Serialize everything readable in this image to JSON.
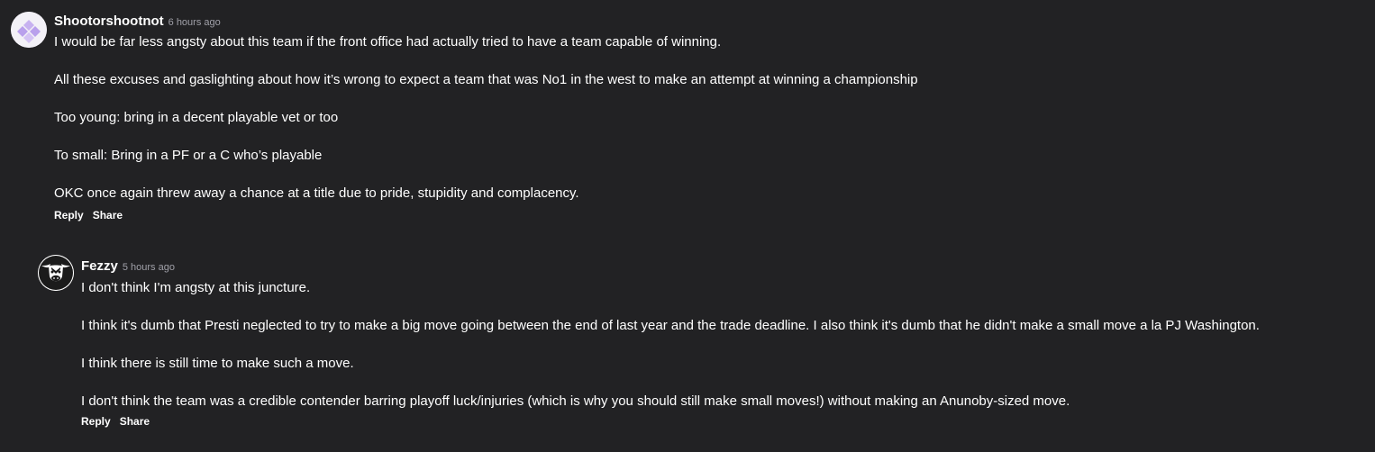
{
  "comments": [
    {
      "author": "Shootorshootnot",
      "timestamp": "6 hours ago",
      "avatar_icon": "purple-diamond-avatar-icon",
      "paragraphs": [
        "I would be far less angsty about this team if the front office had actually tried to have a team capable of winning.",
        "All these excuses and gaslighting about how it’s wrong to expect a team that was No1 in the west to make an attempt at winning a championship",
        "Too young: bring in a decent playable vet or too",
        "To small: Bring in a PF or a C who’s playable",
        "OKC once again threw away a chance at a title due to pride, stupidity and complacency."
      ],
      "reply_label": "Reply",
      "share_label": "Share"
    },
    {
      "author": "Fezzy",
      "timestamp": "5 hours ago",
      "avatar_icon": "bull-head-avatar-icon",
      "paragraphs": [
        "I don't think I'm angsty at this juncture.",
        "I think it's dumb that Presti neglected to try to make a big move going between the end of last year and the trade deadline. I also think it's dumb that he didn't make a small move a la PJ Washington.",
        "I think there is still time to make such a move.",
        "I don't think the team was a credible contender barring playoff luck/injuries (which is why you should still make small moves!) without making an Anunoby-sized move."
      ],
      "reply_label": "Reply",
      "share_label": "Share"
    }
  ],
  "colors": {
    "background": "#222224",
    "text": "#ffffff",
    "timestamp": "#a0a0a8",
    "avatar_purple": "#c9b3f2"
  }
}
